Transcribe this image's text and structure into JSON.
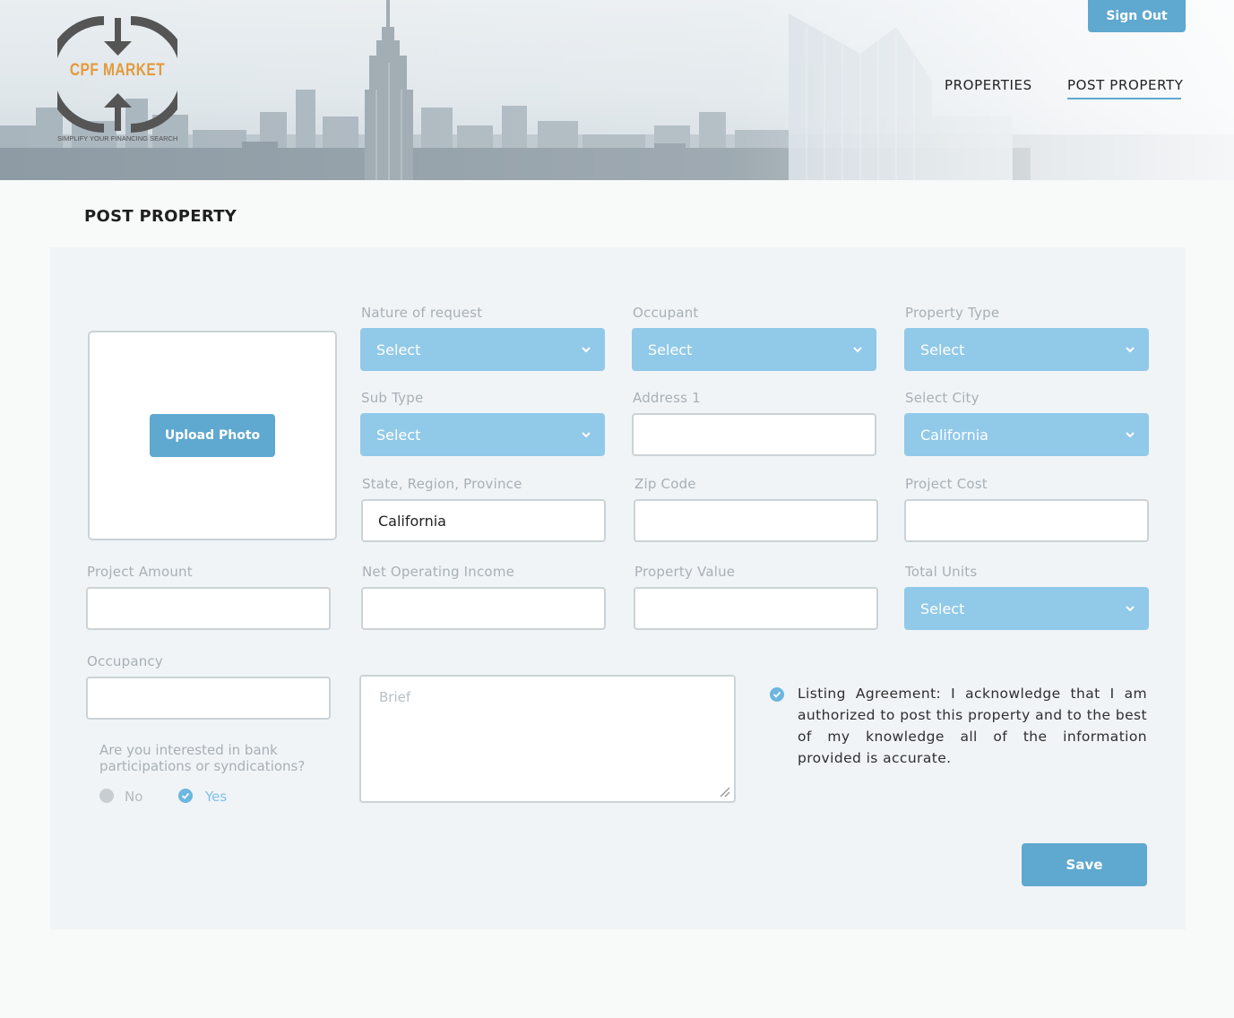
{
  "header": {
    "logo_text": "CPF MARKET",
    "logo_tagline": "SIMPLIFY YOUR FINANCING SEARCH",
    "sign_out": "Sign Out",
    "nav": [
      {
        "label": "PROPERTIES",
        "active": false
      },
      {
        "label": "POST PROPERTY",
        "active": true
      }
    ]
  },
  "page_title": "POST PROPERTY",
  "upload_photo": "Upload Photo",
  "fields": {
    "nature_of_request": {
      "label": "Nature of request",
      "value": "Select"
    },
    "occupant": {
      "label": "Occupant",
      "value": "Select"
    },
    "property_type": {
      "label": "Property Type",
      "value": "Select"
    },
    "sub_type": {
      "label": "Sub Type",
      "value": "Select"
    },
    "address1": {
      "label": "Address 1",
      "value": ""
    },
    "select_city": {
      "label": "Select City",
      "value": "California"
    },
    "state": {
      "label": "State, Region, Province",
      "value": "California"
    },
    "zip": {
      "label": "Zip Code",
      "value": ""
    },
    "project_cost": {
      "label": "Project Cost",
      "value": ""
    },
    "project_amount": {
      "label": "Project Amount",
      "value": ""
    },
    "noi": {
      "label": "Net Operating Income",
      "value": ""
    },
    "property_value": {
      "label": "Property Value",
      "value": ""
    },
    "total_units": {
      "label": "Total Units",
      "value": "Select"
    },
    "occupancy": {
      "label": "Occupancy",
      "value": ""
    }
  },
  "brief": {
    "placeholder": "Brief"
  },
  "participation": {
    "question": "Are you interested in bank participations or syndications?",
    "no_label": "No",
    "yes_label": "Yes",
    "selected": "Yes"
  },
  "agreement": {
    "checked": true,
    "text": "Listing Agreement: I acknowledge that I am authorized to post this property and to the best of my knowledge all of the information provided is accurate."
  },
  "save_label": "Save",
  "colors": {
    "accent": "#5fa8d0",
    "select_bg": "#91c9e9",
    "logo_orange": "#e39a3d",
    "card_bg": "#f0f4f7"
  }
}
